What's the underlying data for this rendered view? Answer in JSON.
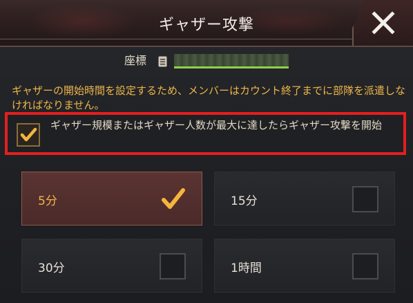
{
  "header": {
    "title": "ギャザー攻撃",
    "close_icon": "close-icon"
  },
  "coordinates": {
    "label": "座標",
    "icon": "document-icon"
  },
  "description": "ギャザーの開始時間を設定するため、メンバーはカウント終了までに部隊を派遣しなければなりません。",
  "auto_start_option": {
    "checked": true,
    "text": "ギャザー規模またはギャザー人数が最大に達したらギャザー攻撃を開始"
  },
  "time_options": [
    {
      "label": "5分",
      "selected": true
    },
    {
      "label": "15分",
      "selected": false
    },
    {
      "label": "30分",
      "selected": false
    },
    {
      "label": "1時間",
      "selected": false
    }
  ],
  "colors": {
    "accent_orange": "#f0b649",
    "highlight_red": "#e41f1f",
    "green_bar": "#8fd24b",
    "check_gold": "#f3b53d"
  }
}
